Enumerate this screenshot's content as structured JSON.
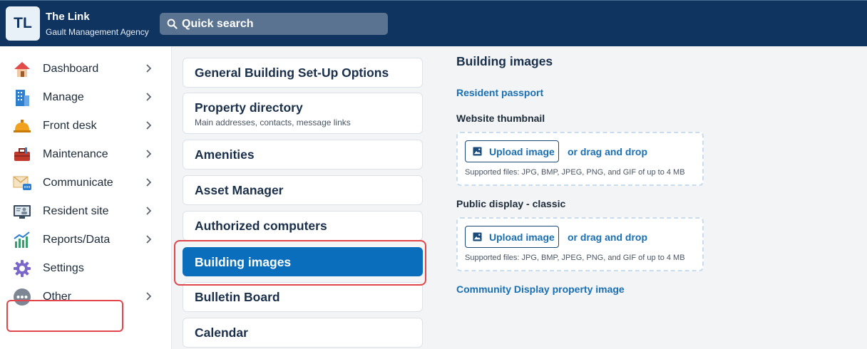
{
  "header": {
    "logo_text": "TL",
    "title": "The Link",
    "subtitle": "Gault Management Agency",
    "search_placeholder": "Quick search"
  },
  "sidebar": {
    "items": [
      {
        "label": "Dashboard",
        "icon": "house-icon"
      },
      {
        "label": "Manage",
        "icon": "building-icon"
      },
      {
        "label": "Front desk",
        "icon": "bell-icon"
      },
      {
        "label": "Maintenance",
        "icon": "toolbox-icon"
      },
      {
        "label": "Communicate",
        "icon": "envelope-chat-icon"
      },
      {
        "label": "Resident site",
        "icon": "monitor-user-icon"
      },
      {
        "label": "Reports/Data",
        "icon": "chart-icon"
      },
      {
        "label": "Settings",
        "icon": "gear-icon"
      },
      {
        "label": "Other",
        "icon": "more-icon"
      }
    ],
    "selected": "Settings"
  },
  "settings_menu": {
    "items": [
      {
        "title": "General Building Set-Up Options",
        "subtitle": ""
      },
      {
        "title": "Property directory",
        "subtitle": "Main addresses, contacts, message links"
      },
      {
        "title": "Amenities",
        "subtitle": ""
      },
      {
        "title": "Asset Manager",
        "subtitle": ""
      },
      {
        "title": "Authorized computers",
        "subtitle": ""
      },
      {
        "title": "Building images",
        "subtitle": ""
      },
      {
        "title": "Bulletin Board",
        "subtitle": ""
      },
      {
        "title": "Calendar",
        "subtitle": ""
      }
    ],
    "active": "Building images"
  },
  "panel": {
    "title": "Building images",
    "resident_passport_link": "Resident passport",
    "website_thumbnail_label": "Website thumbnail",
    "public_display_label": "Public display - classic",
    "upload_label": "Upload image",
    "drag_text": "or drag and drop",
    "supported_text": "Supported files: JPG, BMP, JPEG, PNG, and GIF of up to 4 MB",
    "community_display_link": "Community Display property image"
  },
  "colors": {
    "header_bg": "#0f3460",
    "accent": "#0a6ebd",
    "link": "#1a6fb3",
    "highlight": "#e0474c"
  }
}
